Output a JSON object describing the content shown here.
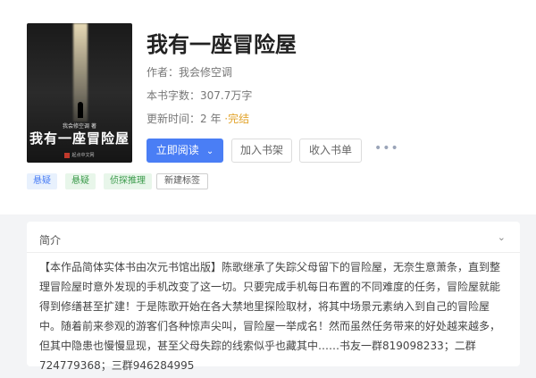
{
  "book": {
    "title": "我有一座冒险屋",
    "author_label": "作者：",
    "author": "我会修空调",
    "wordcount_label": "本书字数：",
    "wordcount": "307.7万字",
    "update_label": "更新时间：",
    "update_ago": "2 年",
    "status": "·完结"
  },
  "cover": {
    "author_line": "我会修空调 著",
    "title": "我有一座冒险屋",
    "publisher": "起点中文网"
  },
  "actions": {
    "read_label": "立即阅读",
    "shelf_label": "加入书架",
    "list_label": "收入书单",
    "more_label": "•••"
  },
  "tags": [
    "悬疑",
    "悬疑",
    "侦探推理"
  ],
  "new_tag_label": "新建标签",
  "intro": {
    "heading": "简介",
    "text": "【本作品简体实体书由次元书馆出版】陈歌继承了失踪父母留下的冒险屋，无奈生意萧条，直到整理冒险屋时意外发现的手机改变了这一切。只要完成手机每日布置的不同难度的任务，冒险屋就能得到修缮甚至扩建！于是陈歌开始在各大禁地里探险取材，将其中场景元素纳入到自己的冒险屋中。随着前来参观的游客们各种惊声尖叫，冒险屋一举成名！然而虽然任务带来的好处越来越多，但其中隐患也慢慢显现，甚至父母失踪的线索似乎也藏其中……书友一群819098233；二群724779368；三群946284995"
  },
  "colors": {
    "accent": "#4a7ef5",
    "status": "#e2a32a",
    "tag_green": "#3a9a4a"
  }
}
